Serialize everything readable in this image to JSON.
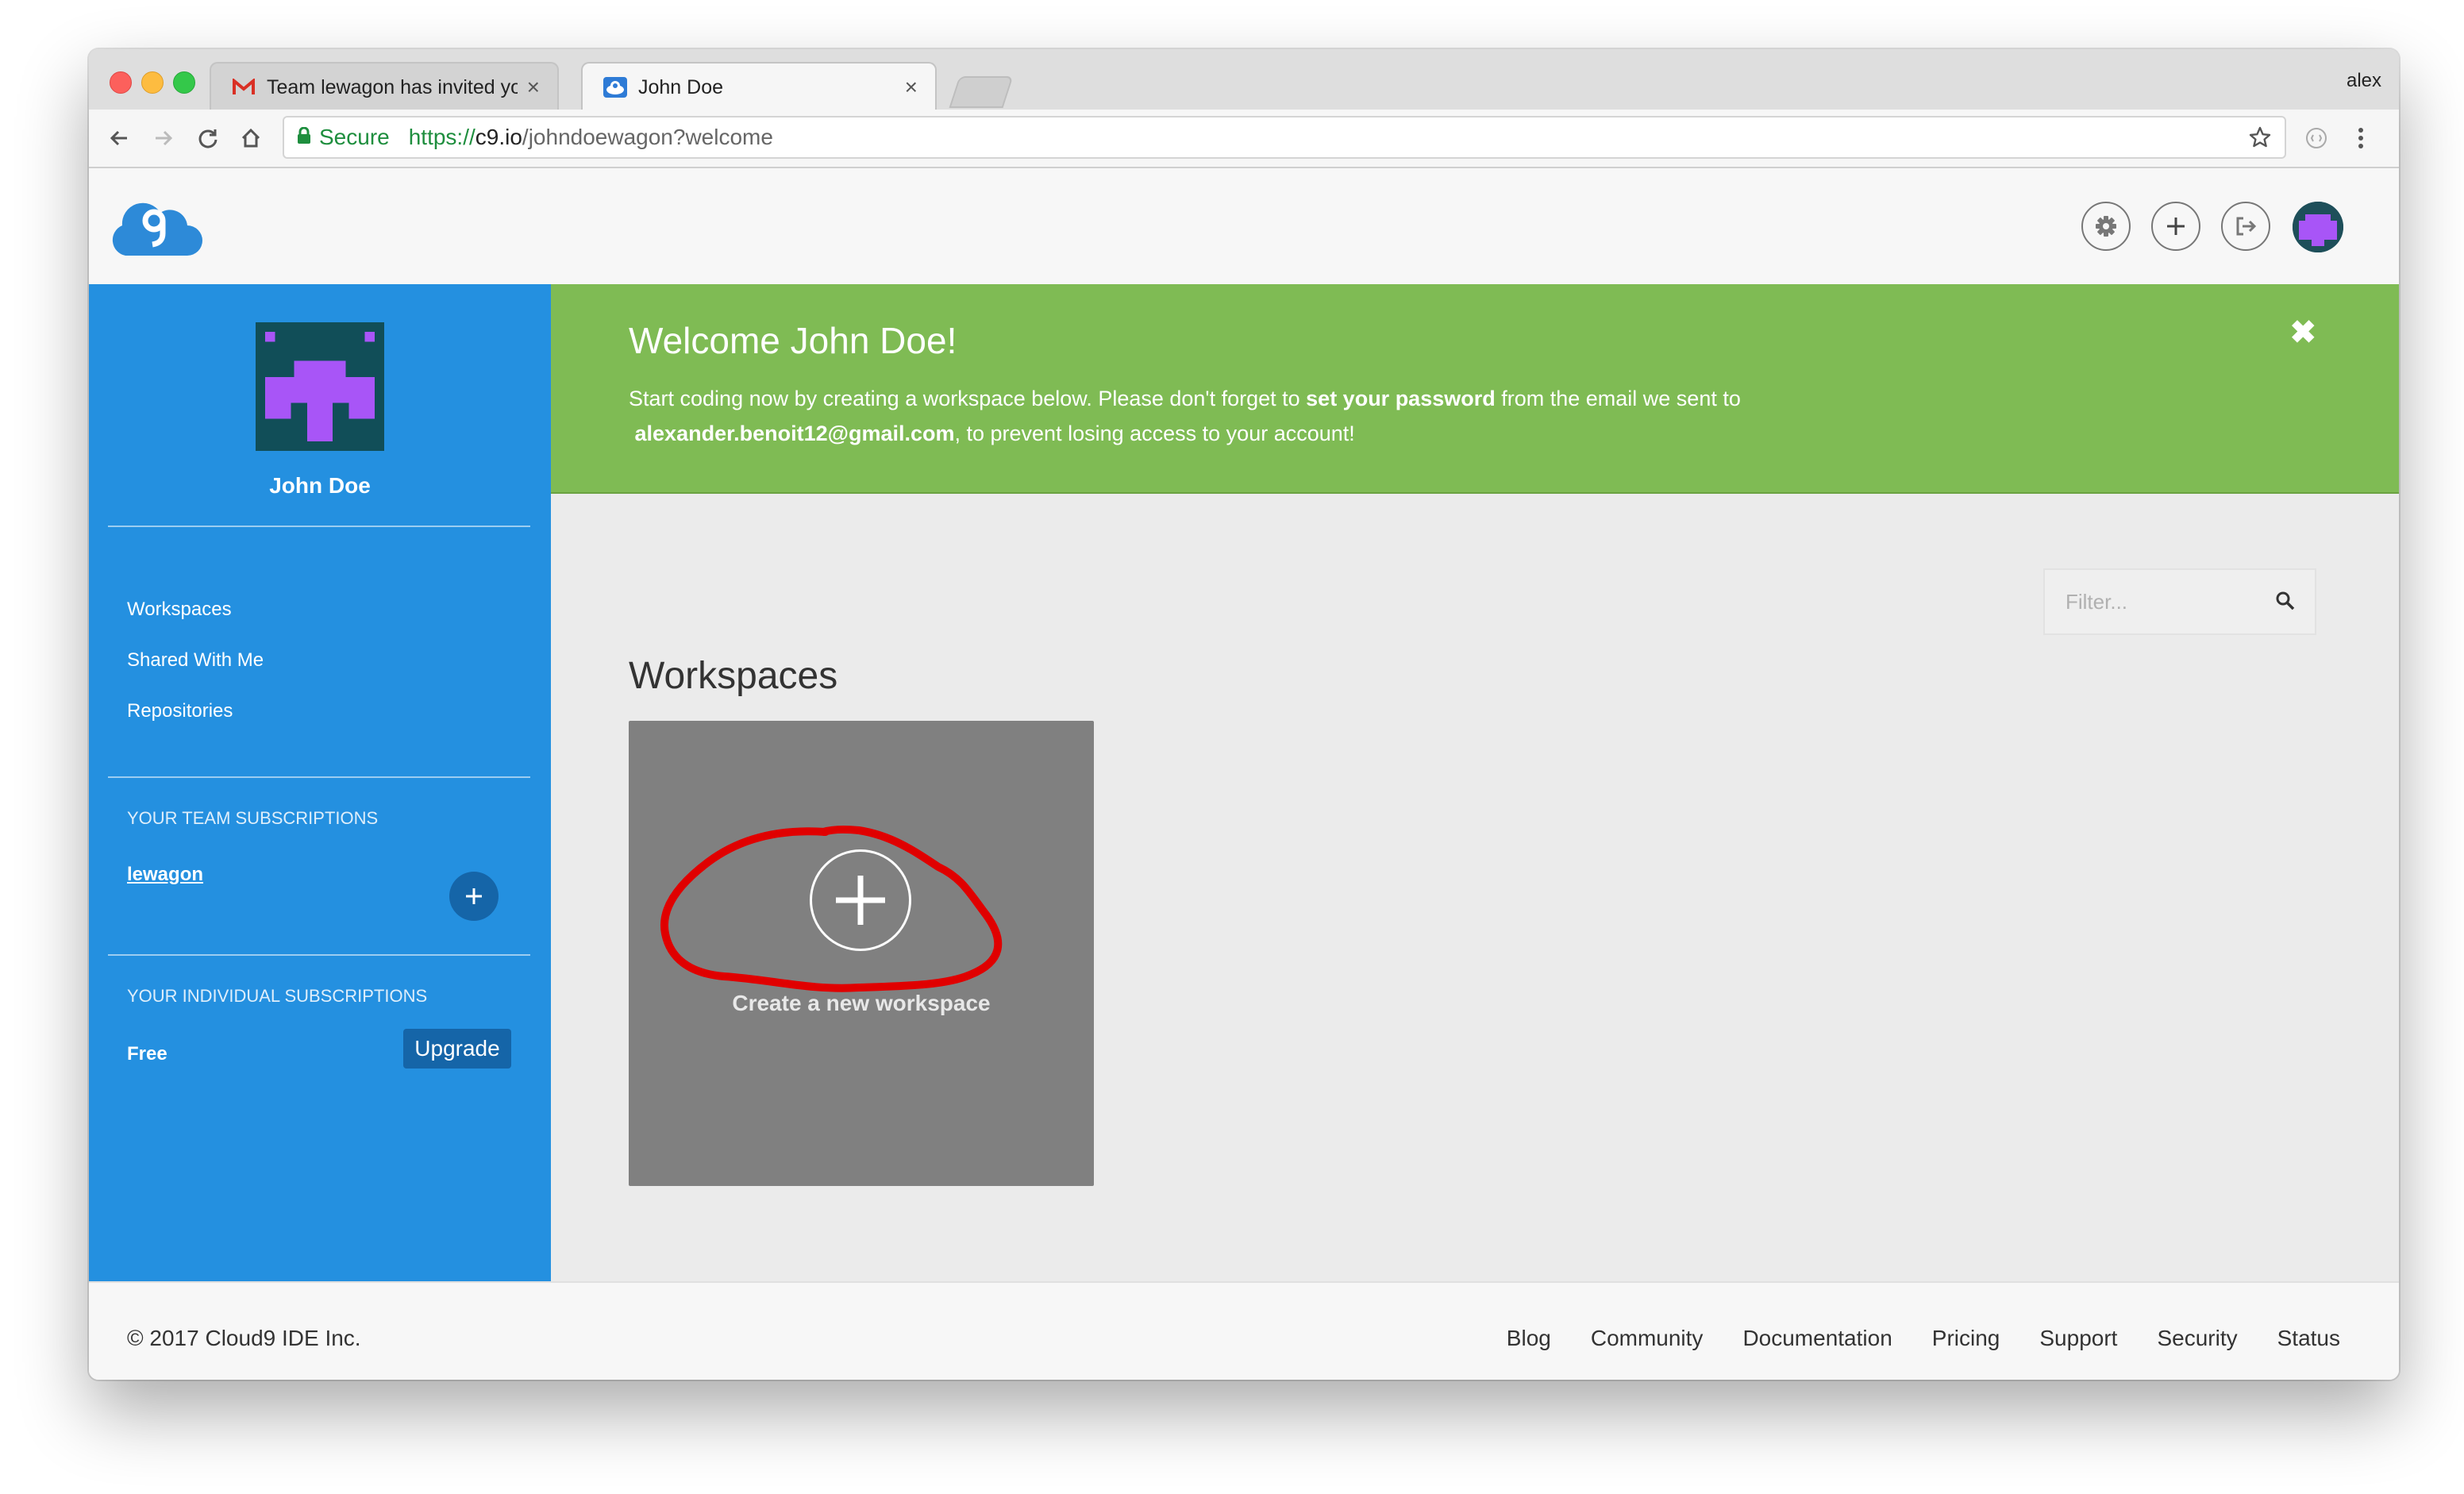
{
  "browser": {
    "tabs": [
      {
        "title": "Team lewagon has invited you",
        "icon": "gmail-icon",
        "active": false
      },
      {
        "title": "John Doe",
        "icon": "cloud9-icon",
        "active": true
      }
    ],
    "profile_name": "alex",
    "secure_label": "Secure",
    "url": {
      "protocol": "https://",
      "host": "c9.io",
      "path": "/johndoewagon?welcome"
    }
  },
  "sidebar": {
    "user_name": "John Doe",
    "nav": [
      {
        "label": "Workspaces"
      },
      {
        "label": "Shared With Me"
      },
      {
        "label": "Repositories"
      }
    ],
    "team_heading": "YOUR TEAM SUBSCRIPTIONS",
    "team_name": "lewagon",
    "individual_heading": "YOUR INDIVIDUAL SUBSCRIPTIONS",
    "plan": "Free",
    "upgrade_label": "Upgrade"
  },
  "banner": {
    "title": "Welcome John Doe!",
    "text_1": "Start coding now by creating a workspace below. Please don't forget to ",
    "text_bold_1": "set your password",
    "text_2": " from the email we sent to ",
    "email": "alexander.benoit12@gmail.com",
    "text_3": ", to prevent losing access to your account!",
    "close_glyph": "✖",
    "color": "#7fbb54"
  },
  "filter": {
    "placeholder": "Filter..."
  },
  "workspaces": {
    "title": "Workspaces",
    "create_label": "Create a new workspace",
    "annotation_color": "#e00000"
  },
  "footer": {
    "copyright": "© 2017 Cloud9 IDE Inc.",
    "links": [
      "Blog",
      "Community",
      "Documentation",
      "Pricing",
      "Support",
      "Security",
      "Status"
    ]
  },
  "colors": {
    "sidebar": "#2490e0",
    "accent_dark": "#1565a8",
    "avatar_bg": "#114e58",
    "avatar_fg": "#a855f7"
  }
}
